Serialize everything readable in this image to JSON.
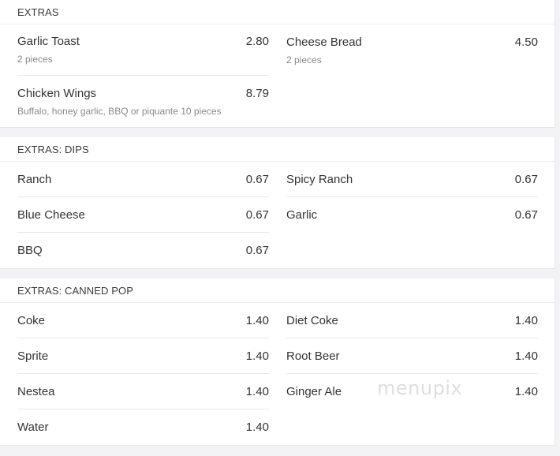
{
  "sections": [
    {
      "title": "EXTRAS",
      "items": [
        {
          "name": "Garlic Toast",
          "price": "2.80",
          "desc": "2 pieces"
        },
        {
          "name": "Cheese Bread",
          "price": "4.50",
          "desc": "2 pieces"
        },
        {
          "name": "Chicken Wings",
          "price": "8.79",
          "desc": "Buffalo, honey garlic, BBQ or piquante 10 pieces"
        }
      ]
    },
    {
      "title": "EXTRAS: DIPS",
      "items": [
        {
          "name": "Ranch",
          "price": "0.67"
        },
        {
          "name": "Spicy Ranch",
          "price": "0.67"
        },
        {
          "name": "Blue Cheese",
          "price": "0.67"
        },
        {
          "name": "Garlic",
          "price": "0.67"
        },
        {
          "name": "BBQ",
          "price": "0.67"
        }
      ]
    },
    {
      "title": "EXTRAS: CANNED POP",
      "items": [
        {
          "name": "Coke",
          "price": "1.40"
        },
        {
          "name": "Diet Coke",
          "price": "1.40"
        },
        {
          "name": "Sprite",
          "price": "1.40"
        },
        {
          "name": "Root Beer",
          "price": "1.40"
        },
        {
          "name": "Nestea",
          "price": "1.40"
        },
        {
          "name": "Ginger Ale",
          "price": "1.40"
        },
        {
          "name": "Water",
          "price": "1.40"
        }
      ]
    }
  ],
  "watermark": "menupix"
}
